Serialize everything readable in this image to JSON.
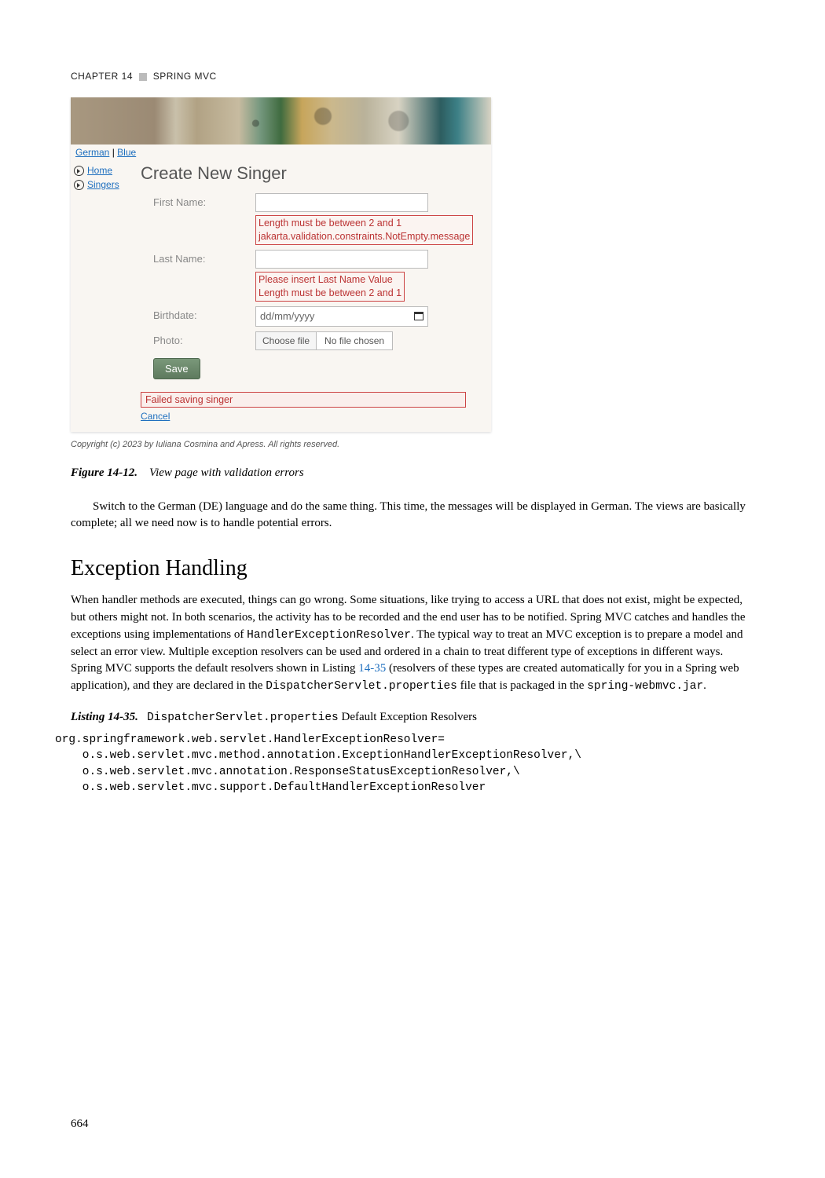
{
  "header": {
    "chapter_label": "CHAPTER 14",
    "chapter_title": "SPRING MVC"
  },
  "screenshot": {
    "lang_links": {
      "german": "German",
      "blue": "Blue"
    },
    "sidebar": {
      "items": [
        {
          "label": "Home"
        },
        {
          "label": "Singers"
        }
      ]
    },
    "form": {
      "title": "Create New Singer",
      "first_name_label": "First Name:",
      "first_name_error1": "Length must be between 2 and 1",
      "first_name_error2": "jakarta.validation.constraints.NotEmpty.message",
      "last_name_label": "Last Name:",
      "last_name_error1": "Please insert Last Name Value",
      "last_name_error2": "Length must be between 2 and 1",
      "birthdate_label": "Birthdate:",
      "birthdate_placeholder": "dd/mm/yyyy",
      "photo_label": "Photo:",
      "choose_file": "Choose file",
      "no_file": "No file chosen",
      "save_label": "Save",
      "fail_message": "Failed saving singer",
      "cancel_label": "Cancel"
    },
    "copyright": "Copyright (c) 2023 by Iuliana Cosmina and Apress. All rights reserved."
  },
  "figure": {
    "label": "Figure 14-12.",
    "title": "View page with validation errors"
  },
  "para1": "Switch to the German (DE) language and do the same thing. This time, the messages will be displayed in German. The views are basically complete; all we need now is to handle potential errors.",
  "section_heading": "Exception Handling",
  "para2_a": "When handler methods are executed, things can go wrong. Some situations, like trying to access a URL that does not exist, might be expected, but others might not. In both scenarios, the activity has to be recorded and the end user has to be notified. Spring MVC catches and handles the exceptions using implementations of ",
  "para2_code1": "HandlerExceptionResolver",
  "para2_b": ". The typical way to treat an MVC exception is to prepare a model and select an error view. Multiple exception resolvers can be used and ordered in a chain to treat different type of exceptions in different ways. Spring MVC supports the default resolvers shown in Listing ",
  "para2_link": "14-35",
  "para2_c": " (resolvers of these types are created automatically for you in a Spring web application), and they are declared in the ",
  "para2_code2": "DispatcherServlet.properties",
  "para2_d": " file that is packaged in the ",
  "para2_code3": "spring-webmvc.jar",
  "para2_e": ".",
  "listing": {
    "label": "Listing 14-35.",
    "code": "DispatcherServlet.properties",
    "title": " Default Exception Resolvers"
  },
  "code_block": "org.springframework.web.servlet.HandlerExceptionResolver=\n    o.s.web.servlet.mvc.method.annotation.ExceptionHandlerExceptionResolver,\\\n    o.s.web.servlet.mvc.annotation.ResponseStatusExceptionResolver,\\\n    o.s.web.servlet.mvc.support.DefaultHandlerExceptionResolver",
  "page_number": "664"
}
